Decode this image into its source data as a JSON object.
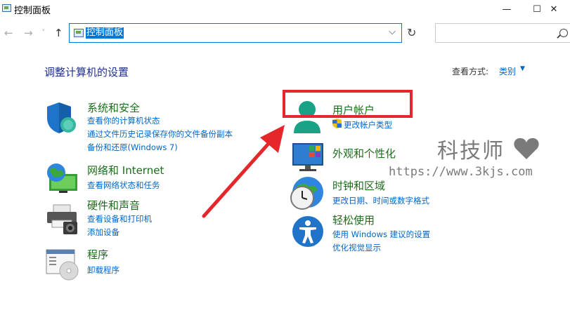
{
  "window": {
    "title": "控制面板",
    "minimize": "—",
    "maximize": "☐",
    "close": "✕"
  },
  "nav": {
    "back": "←",
    "forward": "→",
    "recent": "˅",
    "up": "↑",
    "address": "控制面板",
    "chevron": "⌵",
    "refresh": "↻",
    "search_placeholder": ""
  },
  "main": {
    "heading": "调整计算机的设置",
    "view_by_label": "查看方式:",
    "view_by_value": "类别",
    "categories": [
      {
        "title": "系统和安全",
        "links": [
          "查看你的计算机状态",
          "通过文件历史记录保存你的文件备份副本",
          "备份和还原(Windows 7)"
        ]
      },
      {
        "title": "网络和 Internet",
        "links": [
          "查看网络状态和任务"
        ]
      },
      {
        "title": "硬件和声音",
        "links": [
          "查看设备和打印机",
          "添加设备"
        ]
      },
      {
        "title": "程序",
        "links": [
          "卸载程序"
        ]
      },
      {
        "title": "用户帐户",
        "links": [
          "更改帐户类型"
        ]
      },
      {
        "title": "外观和个性化",
        "links": []
      },
      {
        "title": "时钟和区域",
        "links": [
          "更改日期、时间或数字格式"
        ]
      },
      {
        "title": "轻松使用",
        "links": [
          "使用 Windows 建议的设置",
          "优化视觉显示"
        ]
      }
    ]
  },
  "watermark": {
    "line1": "科技师",
    "line2": "https://www.3kjs.com"
  },
  "colors": {
    "heading": "#1e3287",
    "category_title": "#1b6d1b",
    "link": "#0066cc",
    "annotation_red": "#e5262a"
  }
}
